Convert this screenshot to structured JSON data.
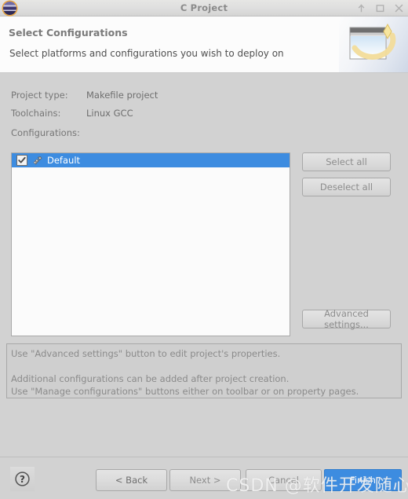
{
  "window": {
    "title": "C Project",
    "icon": "eclipse-logo-icon",
    "controls": [
      {
        "name": "shade-button",
        "icon": "arrow-up-icon"
      },
      {
        "name": "maximize-button",
        "icon": "square-icon"
      },
      {
        "name": "close-button",
        "icon": "close-x-icon"
      }
    ]
  },
  "header": {
    "title": "Select Configurations",
    "subtitle": "Select platforms and configurations you wish to deploy on",
    "banner_icon": "wizard-window-sparkle-icon"
  },
  "fields": {
    "project_type_label": "Project type:",
    "project_type_value": "Makefile project",
    "toolchains_label": "Toolchains:",
    "toolchains_value": "Linux GCC",
    "configurations_label": "Configurations:"
  },
  "configurations": {
    "rows": [
      {
        "label": "Default",
        "checked": true,
        "selected": true,
        "icon": "configuration-gear-icon"
      }
    ]
  },
  "side_buttons": {
    "select_all": "Select all",
    "deselect_all": "Deselect all",
    "advanced_settings": "Advanced settings..."
  },
  "info": {
    "line1": "Use \"Advanced settings\" button to edit project's properties.",
    "line2": "",
    "line3": "Additional configurations can be added after project creation.",
    "line4": "Use \"Manage configurations\" buttons either on toolbar or on property pages."
  },
  "footer": {
    "help": "?",
    "back": "< Back",
    "next": "Next >",
    "cancel": "Cancel",
    "finish": "Finish"
  },
  "watermark": {
    "text": "CSDN @软件开发随心记"
  },
  "colors": {
    "selection_blue": "#3d8ce0",
    "default_button_blue": "#3d8ce0",
    "dialog_gray": "#d2d2d2",
    "header_white": "#fcfcfc",
    "accent_orange": "#e8a33d"
  }
}
